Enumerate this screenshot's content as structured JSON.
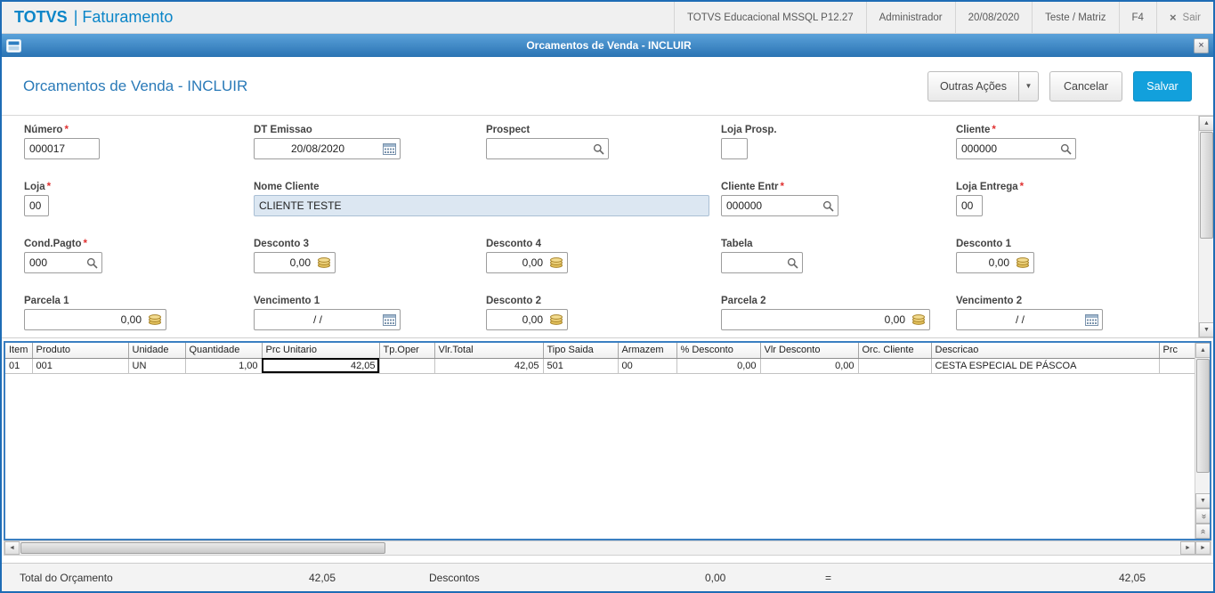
{
  "colors": {
    "brand_blue": "#0b85c8",
    "titlebar_blue": "#2a73b3",
    "save_blue": "#12a0dc",
    "required_red": "#e03131",
    "readonly_bg": "#dce7f2"
  },
  "topbar": {
    "brand_name": "TOTVS",
    "brand_module": "| Faturamento",
    "environment": "TOTVS Educacional MSSQL P12.27",
    "user": "Administrador",
    "date": "20/08/2020",
    "branch": "Teste / Matriz",
    "f4": "F4",
    "sair": "Sair"
  },
  "window": {
    "title": "Orcamentos de Venda - INCLUIR"
  },
  "header": {
    "title": "Orcamentos de Venda - INCLUIR",
    "outras_acoes": "Outras Ações",
    "cancelar": "Cancelar",
    "salvar": "Salvar"
  },
  "form": {
    "required_marker": "*",
    "numero": {
      "label": "Número",
      "value": "000017"
    },
    "dt_emissao": {
      "label": "DT Emissao",
      "value": "20/08/2020"
    },
    "prospect": {
      "label": "Prospect",
      "value": ""
    },
    "loja_prosp": {
      "label": "Loja Prosp.",
      "value": ""
    },
    "cliente": {
      "label": "Cliente",
      "value": "000000"
    },
    "loja": {
      "label": "Loja",
      "value": "00"
    },
    "nome_cliente": {
      "label": "Nome Cliente",
      "value": "CLIENTE TESTE"
    },
    "cliente_entr": {
      "label": "Cliente Entr",
      "value": "000000"
    },
    "loja_entrega": {
      "label": "Loja Entrega",
      "value": "00"
    },
    "cond_pagto": {
      "label": "Cond.Pagto",
      "value": "000"
    },
    "desconto3": {
      "label": "Desconto 3",
      "value": "0,00"
    },
    "desconto4": {
      "label": "Desconto 4",
      "value": "0,00"
    },
    "tabela": {
      "label": "Tabela",
      "value": ""
    },
    "desconto1": {
      "label": "Desconto 1",
      "value": "0,00"
    },
    "parcela1": {
      "label": "Parcela 1",
      "value": "0,00"
    },
    "vencimento1": {
      "label": "Vencimento 1",
      "value": "/ /"
    },
    "desconto2": {
      "label": "Desconto 2",
      "value": "0,00"
    },
    "parcela2": {
      "label": "Parcela 2",
      "value": "0,00"
    },
    "vencimento2": {
      "label": "Vencimento 2",
      "value": "/ /"
    }
  },
  "grid": {
    "columns": [
      "Item",
      "Produto",
      "Unidade",
      "Quantidade",
      "Prc Unitario",
      "Tp.Oper",
      "Vlr.Total",
      "Tipo Saida",
      "Armazem",
      "% Desconto",
      "Vlr Desconto",
      "Orc. Cliente",
      "Descricao",
      "Prc"
    ],
    "rows": [
      [
        "01",
        "001",
        "UN",
        "1,00",
        "42,05",
        "",
        "42,05",
        "501",
        "00",
        "0,00",
        "0,00",
        "",
        "CESTA ESPECIAL DE PÁSCOA",
        ""
      ]
    ]
  },
  "totals": {
    "total_label": "Total do Orçamento",
    "total_value": "42,05",
    "descontos_label": "Descontos",
    "descontos_value": "0,00",
    "equals": "=",
    "grand_total": "42,05"
  }
}
